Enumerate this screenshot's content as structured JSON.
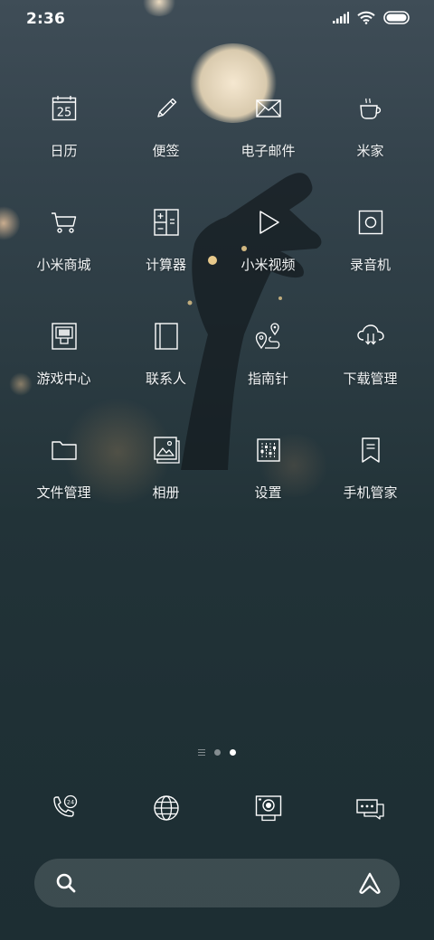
{
  "status_bar": {
    "time": "2:36",
    "icons": [
      "signal-icon",
      "wifi-icon",
      "battery-icon"
    ]
  },
  "apps": [
    {
      "label": "日历",
      "icon": "calendar-icon",
      "icon_text": "25"
    },
    {
      "label": "便签",
      "icon": "pencil-icon"
    },
    {
      "label": "电子邮件",
      "icon": "mail-icon"
    },
    {
      "label": "米家",
      "icon": "cup-icon"
    },
    {
      "label": "小米商城",
      "icon": "cart-icon"
    },
    {
      "label": "计算器",
      "icon": "calculator-icon"
    },
    {
      "label": "小米视频",
      "icon": "play-icon"
    },
    {
      "label": "录音机",
      "icon": "recorder-icon"
    },
    {
      "label": "游戏中心",
      "icon": "game-icon"
    },
    {
      "label": "联系人",
      "icon": "contacts-icon"
    },
    {
      "label": "指南针",
      "icon": "compass-route-icon"
    },
    {
      "label": "下载管理",
      "icon": "cloud-download-icon"
    },
    {
      "label": "文件管理",
      "icon": "folder-icon"
    },
    {
      "label": "相册",
      "icon": "gallery-icon"
    },
    {
      "label": "设置",
      "icon": "settings-sliders-icon"
    },
    {
      "label": "手机管家",
      "icon": "bookmark-shield-icon"
    }
  ],
  "pager": {
    "pages": 2,
    "active": 1
  },
  "dock": [
    {
      "icon": "phone-24-icon"
    },
    {
      "icon": "globe-icon"
    },
    {
      "icon": "camera-icon"
    },
    {
      "icon": "messages-icon"
    }
  ],
  "search": {
    "placeholder": "",
    "icons": [
      "search-icon",
      "assistant-icon"
    ]
  },
  "colors": {
    "text": "#ffffff",
    "wallpaper_top": "#3f4d57",
    "wallpaper_bottom": "#1d2e33"
  }
}
